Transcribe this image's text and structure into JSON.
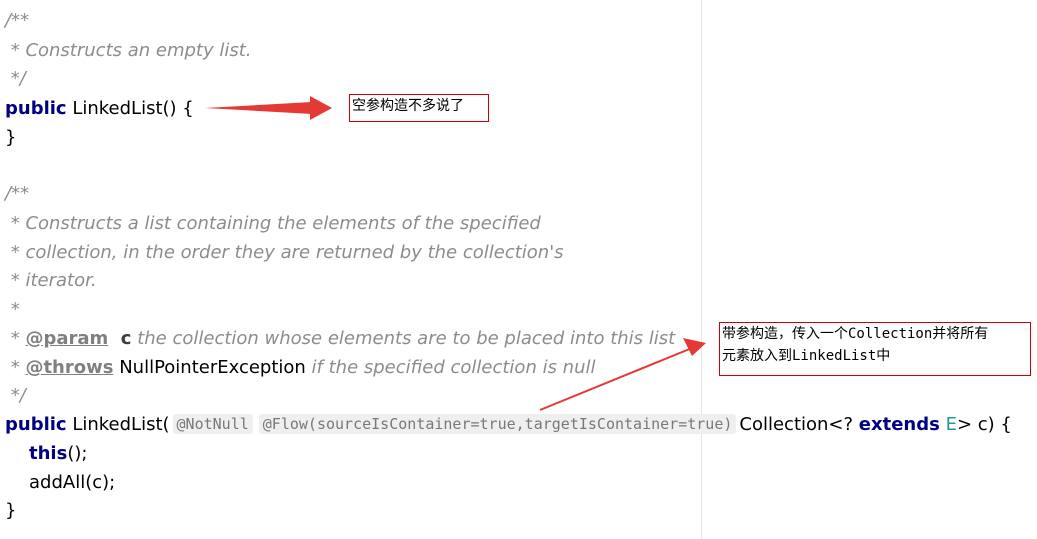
{
  "lines": [
    "/**",
    " * Constructs an empty list.",
    " */",
    "public",
    " LinkedList() {",
    "}",
    "/**",
    " * Constructs a list containing the elements of the specified",
    " * collection, in the order they are returned by the collection's",
    " * iterator.",
    " *",
    " * ",
    "@param",
    "  c",
    " the collection whose elements are to be placed into this list",
    " * ",
    "@throws",
    " NullPointerException",
    " if the specified collection is null",
    " */",
    "public",
    " LinkedList(",
    "@NotNull",
    "@Flow(sourceIsContainer=true,targetIsContainer=true)",
    "Collection<? ",
    "extends",
    "E",
    "> c) {",
    "this",
    "();",
    "addAll(c);",
    "}"
  ],
  "annotations": {
    "empty_ctor_note": "空参构造不多说了",
    "collection_ctor_note_line1": "带参构造，传入一个Collection并将所有",
    "collection_ctor_note_line2": "元素放入到LinkedList中"
  },
  "colors": {
    "arrow": "#e53935",
    "note_border": "#d00000",
    "keyword": "#000080",
    "comment": "#8c8c8c",
    "type_variable": "#20999d"
  }
}
